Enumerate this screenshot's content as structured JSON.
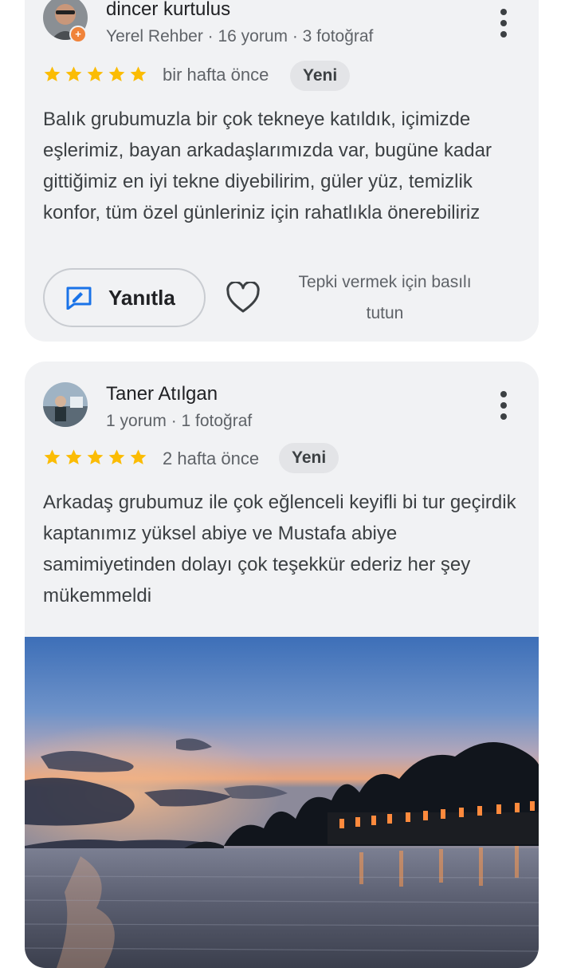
{
  "reviews": [
    {
      "author": "dincer kurtulus",
      "meta": "Yerel Rehber · 16 yorum · 3 fotoğraf",
      "rating": 5,
      "time": "bir hafta önce",
      "chip": "Yeni",
      "text": "Balık grubumuzla bir çok tekneye katıldık, içimizde eşlerimiz, bayan arkadaşlarımızda var, bugüne kadar gittiğimiz en iyi tekne diyebilirim, güler yüz, temizlik konfor, tüm özel günleriniz için rahatlıkla önerebiliriz",
      "reply_label": "Yanıtla",
      "reaction_hint": "Tepki vermek için basılı tutun"
    },
    {
      "author": "Taner Atılgan",
      "meta": "1 yorum · 1 fotoğraf",
      "rating": 5,
      "time": "2 hafta önce",
      "chip": "Yeni",
      "text": "Arkadaş grubumuz ile çok eğlenceli keyifli bi tur geçirdik kaptanımız yüksel abiye ve Mustafa abiye samimiyetinden dolayı çok teşekkür ederiz her şey mükemmeldi"
    }
  ],
  "colors": {
    "card_bg": "#f1f2f4",
    "star": "#fbbc04",
    "chip_bg": "#e3e4e7",
    "reply_icon": "#1a73e8",
    "badge": "#f0833a"
  },
  "icons": {
    "more": "more-vert-icon",
    "reply": "reply-icon",
    "heart": "heart-outline-icon",
    "star": "star-icon",
    "local_guide": "local-guide-badge-icon"
  }
}
